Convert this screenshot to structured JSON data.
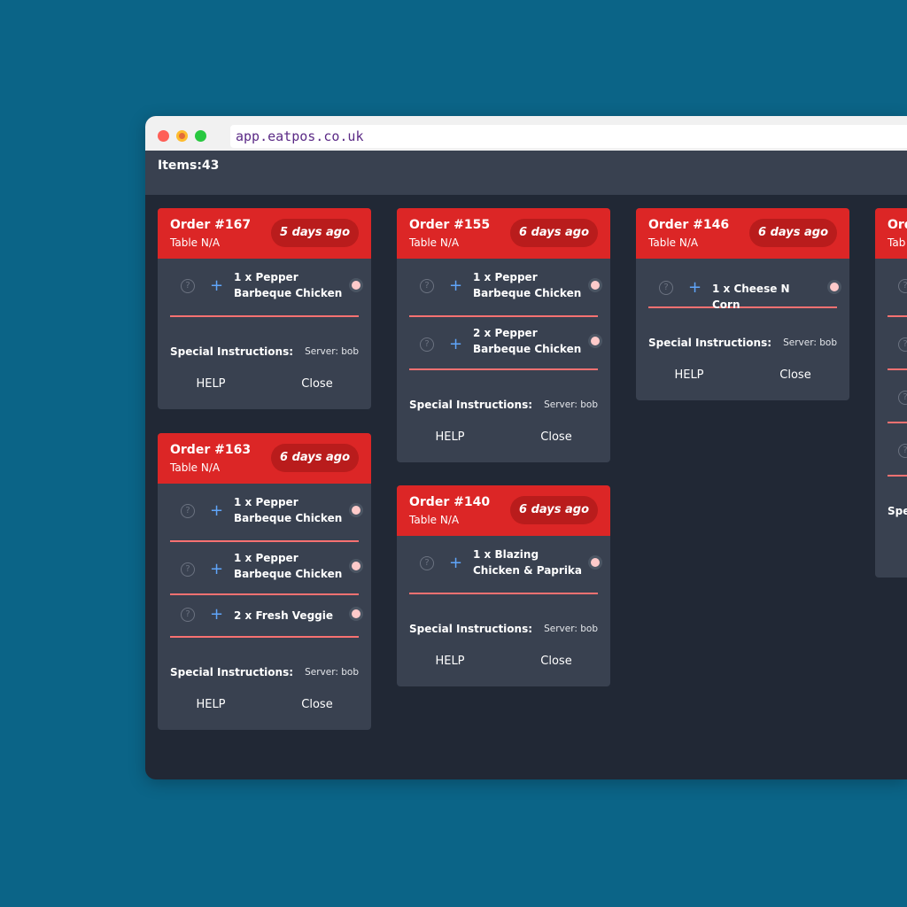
{
  "browser": {
    "url": "app.eatpos.co.uk"
  },
  "header": {
    "items_count": "Items:43"
  },
  "labels": {
    "special_instructions": "Special Instructions:",
    "help": "HELP",
    "close": "Close"
  },
  "orders": [
    {
      "order": "Order #167",
      "table": "Table N/A",
      "age": "5 days ago",
      "server": "Server: bob",
      "items": [
        "1 x Pepper Barbeque Chicken"
      ]
    },
    {
      "order": "Order #163",
      "table": "Table N/A",
      "age": "6 days ago",
      "server": "Server: bob",
      "items": [
        "1 x Pepper Barbeque Chicken",
        "1 x Pepper Barbeque Chicken",
        "2 x Fresh Veggie"
      ]
    },
    {
      "order": "Order #155",
      "table": "Table N/A",
      "age": "6 days ago",
      "server": "Server: bob",
      "items": [
        "1 x Pepper Barbeque Chicken",
        "2 x Pepper Barbeque Chicken"
      ]
    },
    {
      "order": "Order #140",
      "table": "Table N/A",
      "age": "6 days ago",
      "server": "Server: bob",
      "items": [
        "1 x Blazing Chicken & Paprika"
      ]
    },
    {
      "order": "Order #146",
      "table": "Table N/A",
      "age": "6 days ago",
      "server": "Server: bob",
      "items": [
        "1 x Cheese N Corn"
      ]
    },
    {
      "order": "Ord",
      "table": "Tab",
      "age": "",
      "server": "",
      "items": [
        "",
        "",
        "",
        ""
      ],
      "special_partial": "Spe"
    }
  ],
  "colors": {
    "page_bg": "#0b6487",
    "app_bg": "#212835",
    "card_bg": "#394150",
    "order_header": "#dc2626",
    "age_badge": "#b91c1c",
    "item_divider": "#f87171",
    "plus_icon": "#60a5fa",
    "status_dot": "#fecaca"
  },
  "icons": {
    "help": "question-circle-icon",
    "add": "plus-icon",
    "status": "status-dot-icon"
  }
}
